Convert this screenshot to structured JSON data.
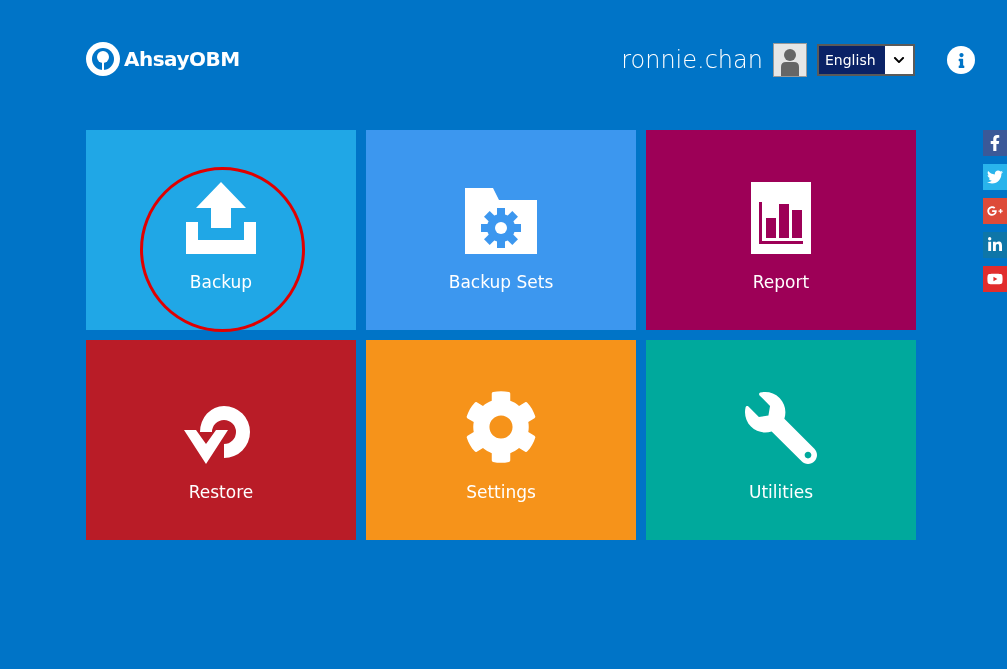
{
  "logo": {
    "text": "AhsayOBM"
  },
  "user": {
    "name": "ronnie.chan"
  },
  "language": {
    "value": "English"
  },
  "tiles": [
    {
      "kind": "backup",
      "label": "Backup",
      "color": "#20a7e6",
      "circled": true
    },
    {
      "kind": "backup_sets",
      "label": "Backup Sets",
      "color": "#3c97ef",
      "circled": false
    },
    {
      "kind": "report",
      "label": "Report",
      "color": "#9d0057",
      "circled": false
    },
    {
      "kind": "restore",
      "label": "Restore",
      "color": "#b91c27",
      "circled": false
    },
    {
      "kind": "settings",
      "label": "Settings",
      "color": "#f6931a",
      "circled": false
    },
    {
      "kind": "utilities",
      "label": "Utilities",
      "color": "#00a99c",
      "circled": false
    }
  ],
  "social": [
    {
      "kind": "facebook",
      "color": "#3b5998"
    },
    {
      "kind": "twitter",
      "color": "#29b4ec"
    },
    {
      "kind": "googleplus",
      "color": "#dd4b39"
    },
    {
      "kind": "linkedin",
      "color": "#0e76a8"
    },
    {
      "kind": "youtube",
      "color": "#e12d2d"
    }
  ]
}
